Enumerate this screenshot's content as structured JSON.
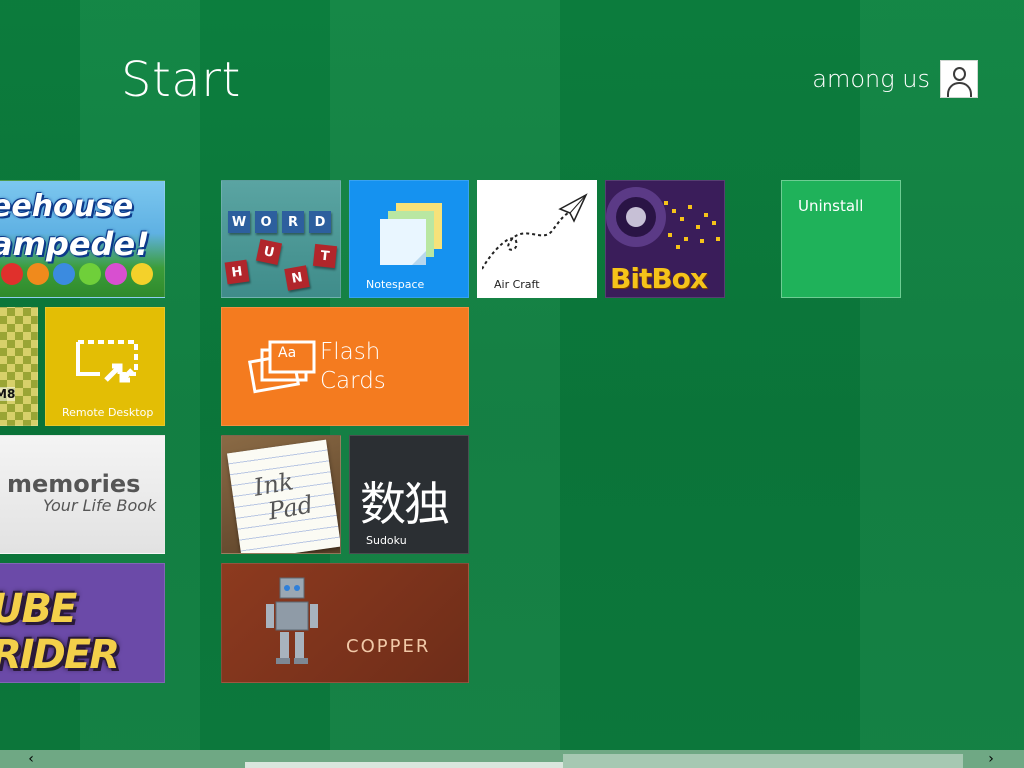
{
  "header": {
    "title": "Start",
    "user_name": "among us"
  },
  "tiles": {
    "treehouse": {
      "line1": "eehouse",
      "line2": "ampede!"
    },
    "chess": {
      "label": "M8"
    },
    "remote_desktop": {
      "caption": "Remote Desktop",
      "icon": "remote-desktop-icon"
    },
    "memories": {
      "line1": "memories",
      "line2": "Your Life Book"
    },
    "cube_rider": {
      "graffiti": "UBE RIDER"
    },
    "word_hunt": {
      "letters_top": [
        "W",
        "O",
        "R",
        "D"
      ],
      "letters_bottom": [
        "H",
        "U",
        "N",
        "T"
      ]
    },
    "notespace": {
      "caption": "Notespace",
      "icon": "sticky-notes-icon"
    },
    "air_craft": {
      "caption": "Air Craft",
      "icon": "paper-plane-icon"
    },
    "bitbox": {
      "label": "BitBox"
    },
    "uninstall": {
      "label": "Uninstall"
    },
    "flash_cards": {
      "line1": "Flash",
      "line2": "Cards",
      "icon": "cards-icon",
      "icon_text": "Aa"
    },
    "ink_pad": {
      "line1": "Ink",
      "line2": "Pad"
    },
    "sudoku": {
      "glyphs": "数独",
      "caption": "Sudoku"
    },
    "copper": {
      "label": "COPPER",
      "icon": "robot-icon"
    }
  },
  "scrollbar": {
    "left_arrow": "‹",
    "right_arrow": "›"
  },
  "colors": {
    "background": "#0f7a3a",
    "remote_desktop": "#e3be05",
    "notespace": "#1592f0",
    "flash_cards": "#f47b1f",
    "uninstall": "#1fb25a",
    "sudoku": "#2b2f33",
    "copper": "#8d3a1f",
    "cube_rider": "#6b4aa8"
  }
}
